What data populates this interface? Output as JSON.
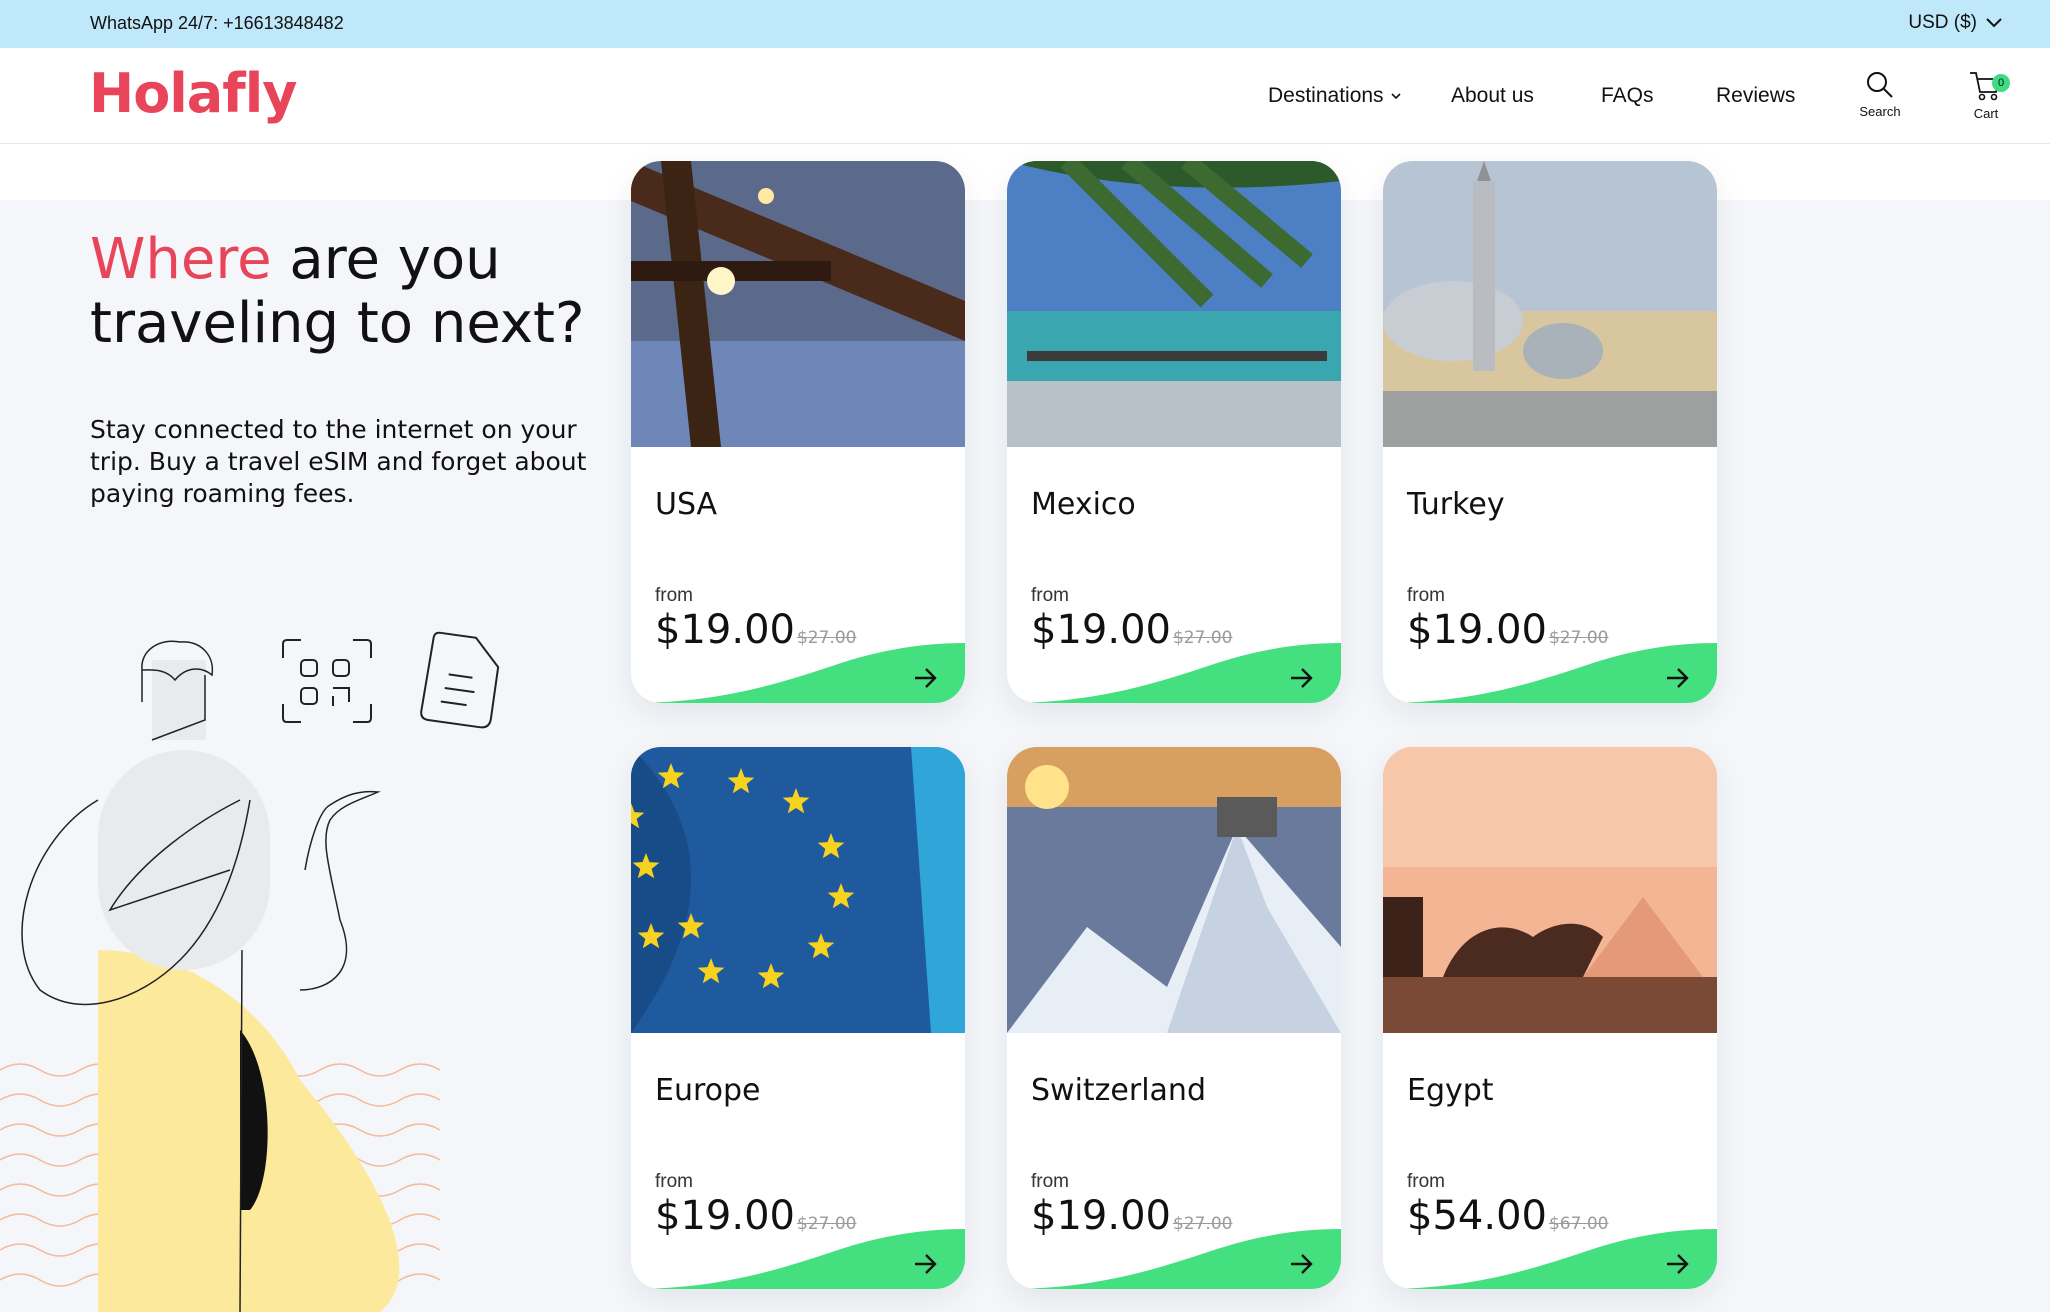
{
  "topbar": {
    "whatsapp": "WhatsApp 24/7: +16613848482",
    "currency": "USD ($)"
  },
  "header": {
    "logo": "Holafly",
    "nav": {
      "destinations": "Destinations",
      "about": "About us",
      "faqs": "FAQs",
      "reviews": "Reviews"
    },
    "search_label": "Search",
    "cart_label": "Cart",
    "cart_count": "0"
  },
  "hero": {
    "title_accent": "Where",
    "title_rest": "are you traveling to next?",
    "description": "Stay connected to the internet on your trip. Buy a travel eSIM and forget about paying roaming fees."
  },
  "cards": [
    {
      "name": "USA",
      "from": "from",
      "price": "$19.00",
      "old_price": "$27.00"
    },
    {
      "name": "Mexico",
      "from": "from",
      "price": "$19.00",
      "old_price": "$27.00"
    },
    {
      "name": "Turkey",
      "from": "from",
      "price": "$19.00",
      "old_price": "$27.00"
    },
    {
      "name": "Europe",
      "from": "from",
      "price": "$19.00",
      "old_price": "$27.00"
    },
    {
      "name": "Switzerland",
      "from": "from",
      "price": "$19.00",
      "old_price": "$27.00"
    },
    {
      "name": "Egypt",
      "from": "from",
      "price": "$54.00",
      "old_price": "$67.00"
    }
  ],
  "colors": {
    "brand": "#e8445a",
    "accent_green": "#44e07f",
    "topbar_bg": "#bfe9fb"
  },
  "icons": [
    "chevron-down-icon",
    "search-icon",
    "cart-icon",
    "arrow-right-icon",
    "qr-code-icon",
    "document-icon"
  ]
}
